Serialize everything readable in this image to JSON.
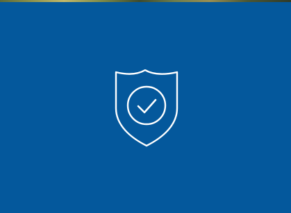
{
  "colors": {
    "panel_background": "#04589c",
    "icon_stroke": "#ffffff"
  },
  "icons": {
    "center_icon": "shield-check-icon"
  }
}
